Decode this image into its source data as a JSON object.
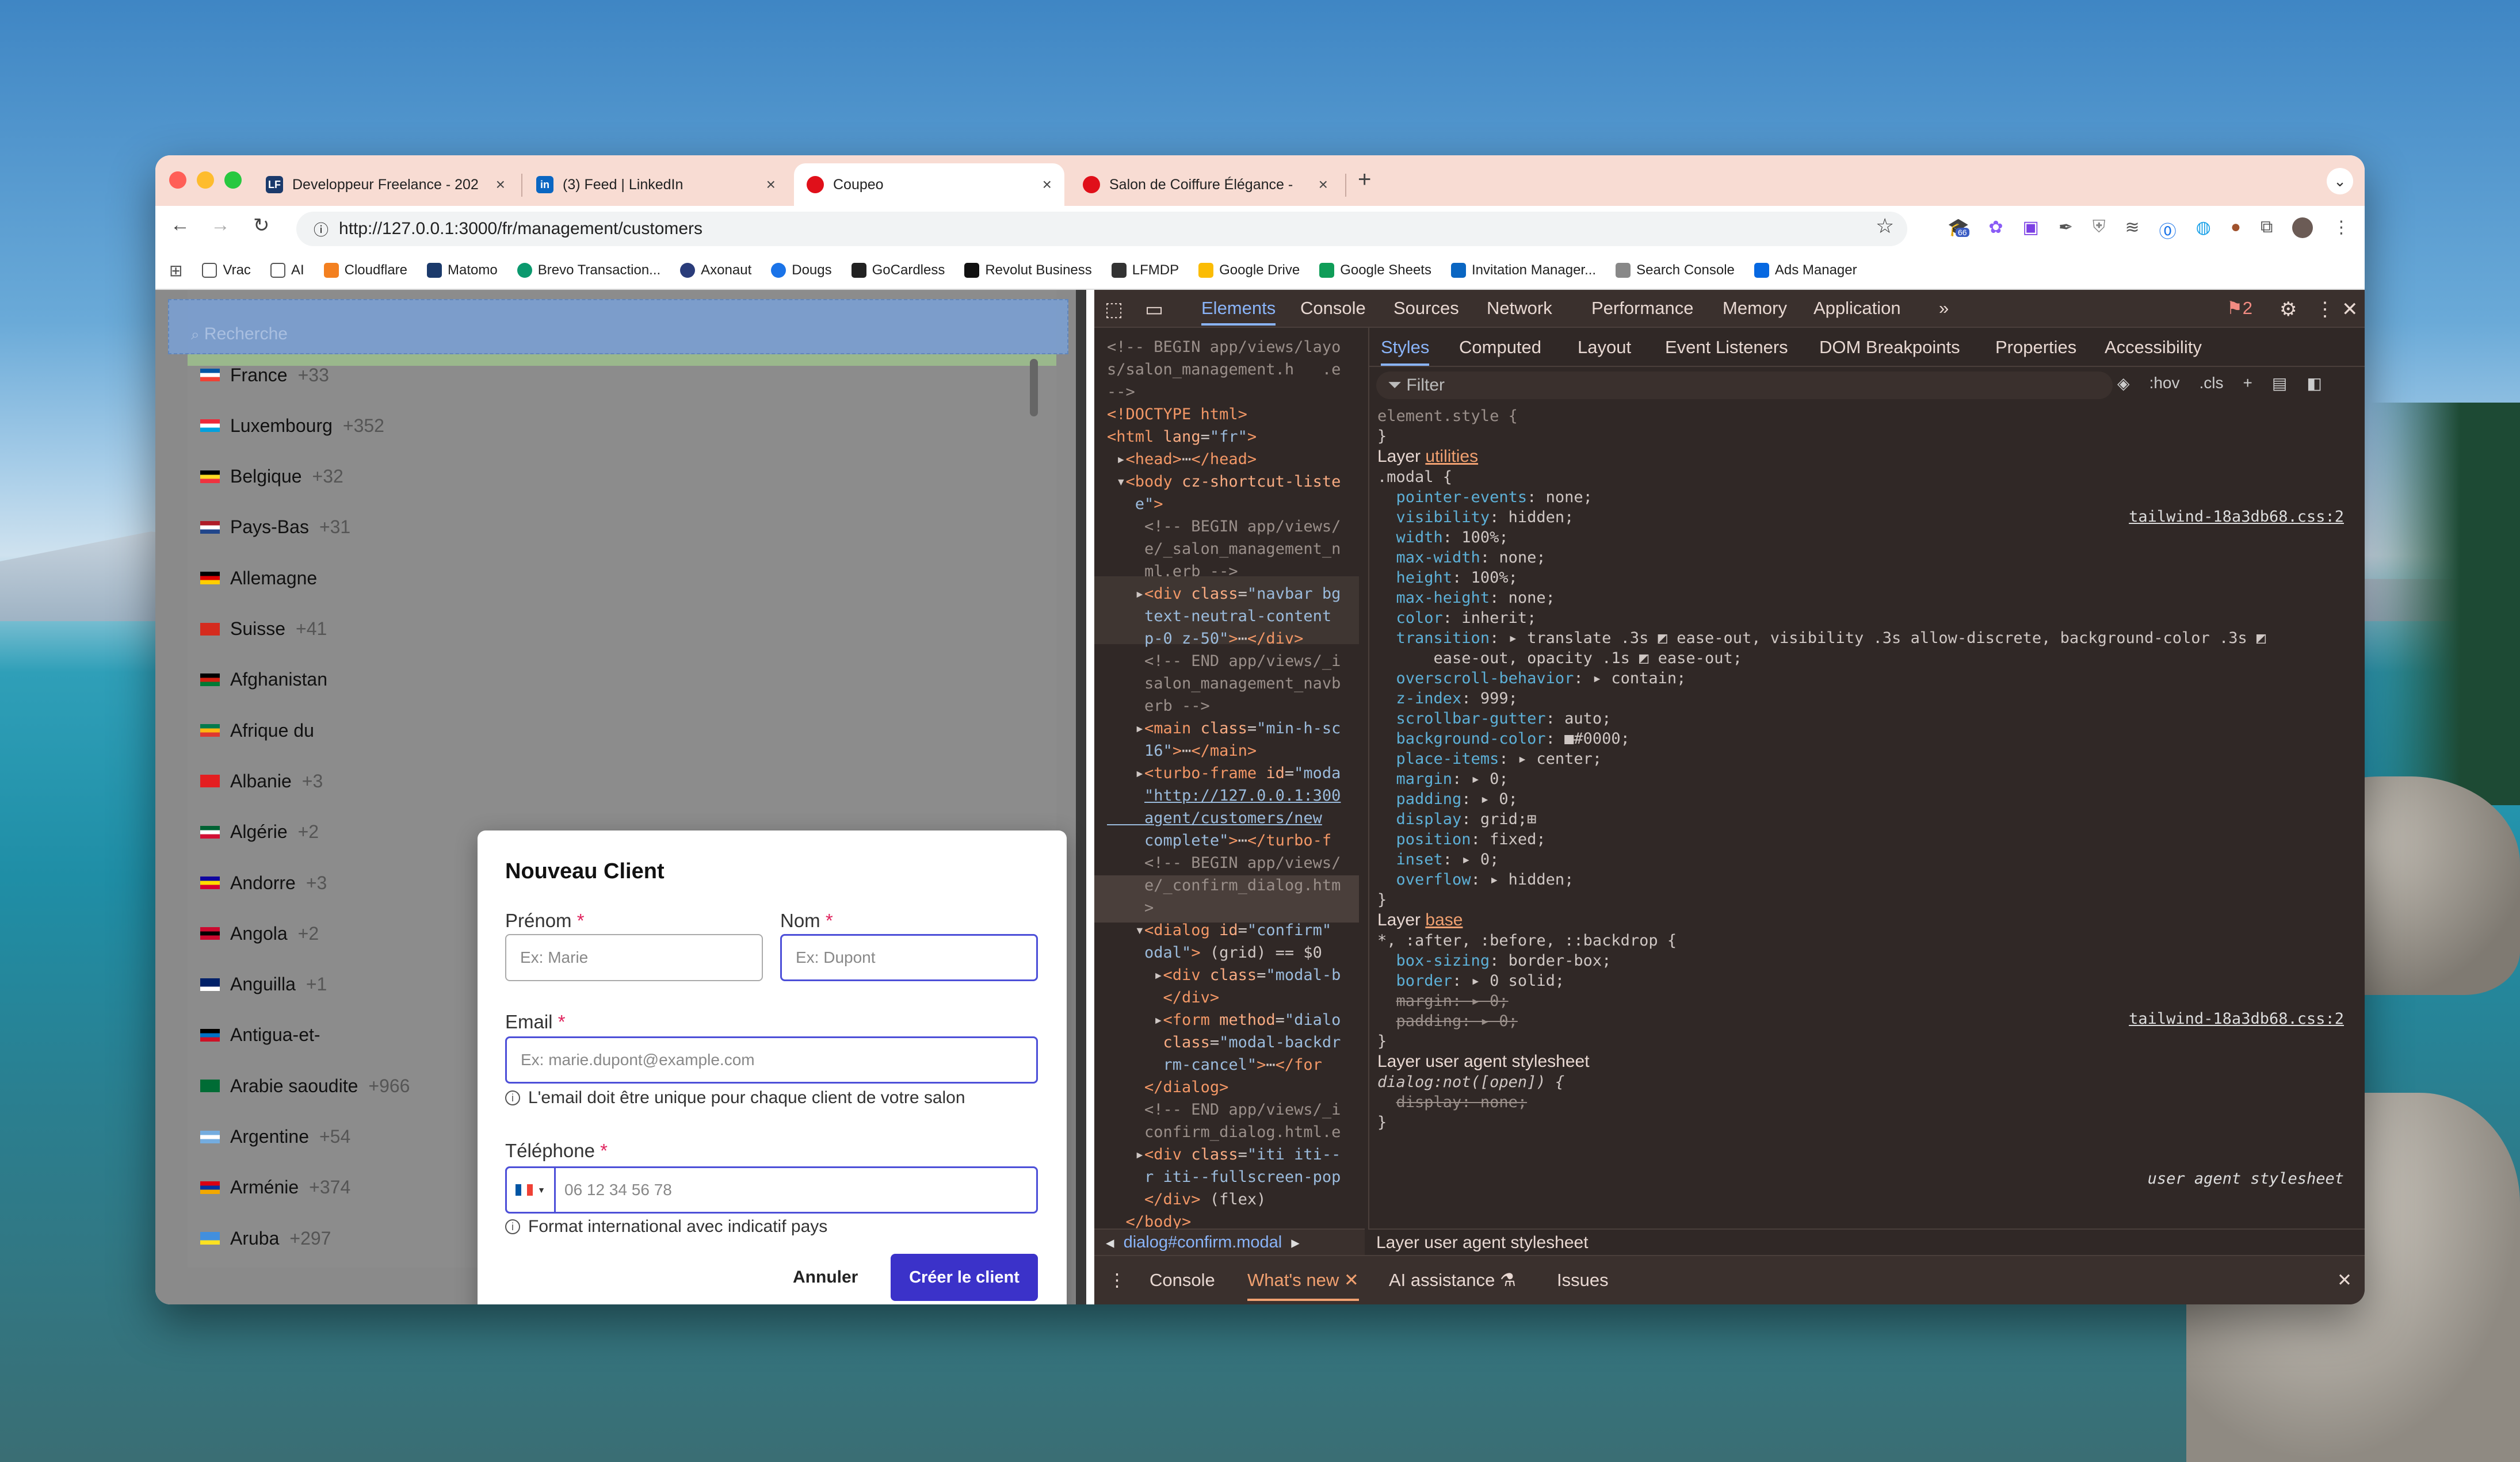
{
  "browser": {
    "tabs": [
      {
        "title": "Developpeur Freelance - 202",
        "icon": "LF",
        "color": "#1b3a6b"
      },
      {
        "title": "(3) Feed | LinkedIn",
        "icon": "in",
        "color": "#0a66c2"
      },
      {
        "title": "Coupeo",
        "icon": "",
        "color": "#e0101a"
      },
      {
        "title": "Salon de Coiffure Élégance -",
        "icon": "",
        "color": "#e0101a"
      }
    ],
    "new_tab": "+",
    "url": "http://127.0.0.1:3000/fr/management/customers",
    "extension_badge": "66",
    "bookmarks": [
      {
        "label": "Vrac",
        "icon": "folder-icon"
      },
      {
        "label": "AI",
        "icon": "folder-icon"
      },
      {
        "label": "Cloudflare",
        "icon": "cloudflare-icon"
      },
      {
        "label": "Matomo",
        "icon": "matomo-icon"
      },
      {
        "label": "Brevo Transaction...",
        "icon": "brevo-icon"
      },
      {
        "label": "Axonaut",
        "icon": "axonaut-icon"
      },
      {
        "label": "Dougs",
        "icon": "dougs-icon"
      },
      {
        "label": "GoCardless",
        "icon": "gocardless-icon"
      },
      {
        "label": "Revolut Business",
        "icon": "revolut-icon"
      },
      {
        "label": "LFMDP",
        "icon": "lfmdp-icon"
      },
      {
        "label": "Google Drive",
        "icon": "drive-icon"
      },
      {
        "label": "Google Sheets",
        "icon": "sheets-icon"
      },
      {
        "label": "Invitation Manager...",
        "icon": "linkedin-icon"
      },
      {
        "label": "Search Console",
        "icon": "search-console-icon"
      },
      {
        "label": "Ads Manager",
        "icon": "meta-icon"
      }
    ]
  },
  "page": {
    "search_placeholder": "Recherche",
    "countries": [
      {
        "name": "France",
        "code": "+33",
        "flag": [
          "#0055a4",
          "#ffffff",
          "#ef4135"
        ]
      },
      {
        "name": "Luxembourg",
        "code": "+352",
        "flag": [
          "#ed2939",
          "#ffffff",
          "#00a1de"
        ]
      },
      {
        "name": "Belgique",
        "code": "+32",
        "flag": [
          "#000000",
          "#fdda24",
          "#ef3340"
        ]
      },
      {
        "name": "Pays-Bas",
        "code": "+31",
        "flag": [
          "#ae1c28",
          "#ffffff",
          "#21468b"
        ]
      },
      {
        "name": "Allemagne",
        "code": "",
        "flag": [
          "#000000",
          "#dd0000",
          "#ffce00"
        ]
      },
      {
        "name": "Suisse",
        "code": "+41",
        "flag": [
          "#d52b1e",
          "#d52b1e",
          "#d52b1e"
        ]
      },
      {
        "name": "Afghanistan",
        "code": "",
        "flag": [
          "#000000",
          "#d32011",
          "#007a36"
        ]
      },
      {
        "name": "Afrique du",
        "code": "",
        "flag": [
          "#007a4d",
          "#ffb612",
          "#de3831"
        ]
      },
      {
        "name": "Albanie",
        "code": "+3",
        "flag": [
          "#e41e20",
          "#e41e20",
          "#e41e20"
        ]
      },
      {
        "name": "Algérie",
        "code": "+2",
        "flag": [
          "#006233",
          "#ffffff",
          "#d21034"
        ]
      },
      {
        "name": "Andorre",
        "code": "+3",
        "flag": [
          "#10069f",
          "#fedd00",
          "#d50032"
        ]
      },
      {
        "name": "Angola",
        "code": "+2",
        "flag": [
          "#cc092f",
          "#000000",
          "#cc092f"
        ]
      },
      {
        "name": "Anguilla",
        "code": "+1",
        "flag": [
          "#012169",
          "#012169",
          "#ffffff"
        ]
      },
      {
        "name": "Antigua-et-",
        "code": "",
        "flag": [
          "#000000",
          "#0072c6",
          "#ce1126"
        ]
      },
      {
        "name": "Arabie saoudite",
        "code": "+966",
        "flag": [
          "#006c35",
          "#006c35",
          "#006c35"
        ]
      },
      {
        "name": "Argentine",
        "code": "+54",
        "flag": [
          "#74acdf",
          "#ffffff",
          "#74acdf"
        ]
      },
      {
        "name": "Arménie",
        "code": "+374",
        "flag": [
          "#d90012",
          "#0033a0",
          "#f2a800"
        ]
      },
      {
        "name": "Aruba",
        "code": "+297",
        "flag": [
          "#418fde",
          "#418fde",
          "#fbe122"
        ]
      }
    ]
  },
  "modal": {
    "title": "Nouveau Client",
    "firstname_label": "Prénom",
    "firstname_placeholder": "Ex: Marie",
    "lastname_label": "Nom",
    "lastname_placeholder": "Ex: Dupont",
    "email_label": "Email",
    "email_placeholder": "Ex: marie.dupont@example.com",
    "email_hint": "L'email doit être unique pour chaque client de votre salon",
    "phone_label": "Téléphone",
    "phone_placeholder": "06 12 34 56 78",
    "phone_hint": "Format international avec indicatif pays",
    "required_mark": "*",
    "cancel": "Annuler",
    "submit": "Créer le client"
  },
  "devtools": {
    "tabs": [
      "Elements",
      "Console",
      "Sources",
      "Network",
      "Performance",
      "Memory",
      "Application"
    ],
    "more": "»",
    "error_count": "2",
    "style_tabs": [
      "Styles",
      "Computed",
      "Layout",
      "Event Listeners",
      "DOM Breakpoints",
      "Properties",
      "Accessibility"
    ],
    "filter_placeholder": "Filter",
    "hov": ":hov",
    "cls": ".cls",
    "breadcrumb": "dialog#confirm.modal",
    "ua_layer": "Layer user agent stylesheet",
    "drawer_tabs": [
      "Console",
      "What's new",
      "AI assistance",
      "Issues"
    ],
    "stylesheet": "tailwind-18a3db68.css:2",
    "ua_source": "user agent stylesheet",
    "layer_utilities": "utilities",
    "layer_base": "base",
    "layer_prefix": "Layer",
    "ua_layer_label": "Layer user agent stylesheet"
  }
}
